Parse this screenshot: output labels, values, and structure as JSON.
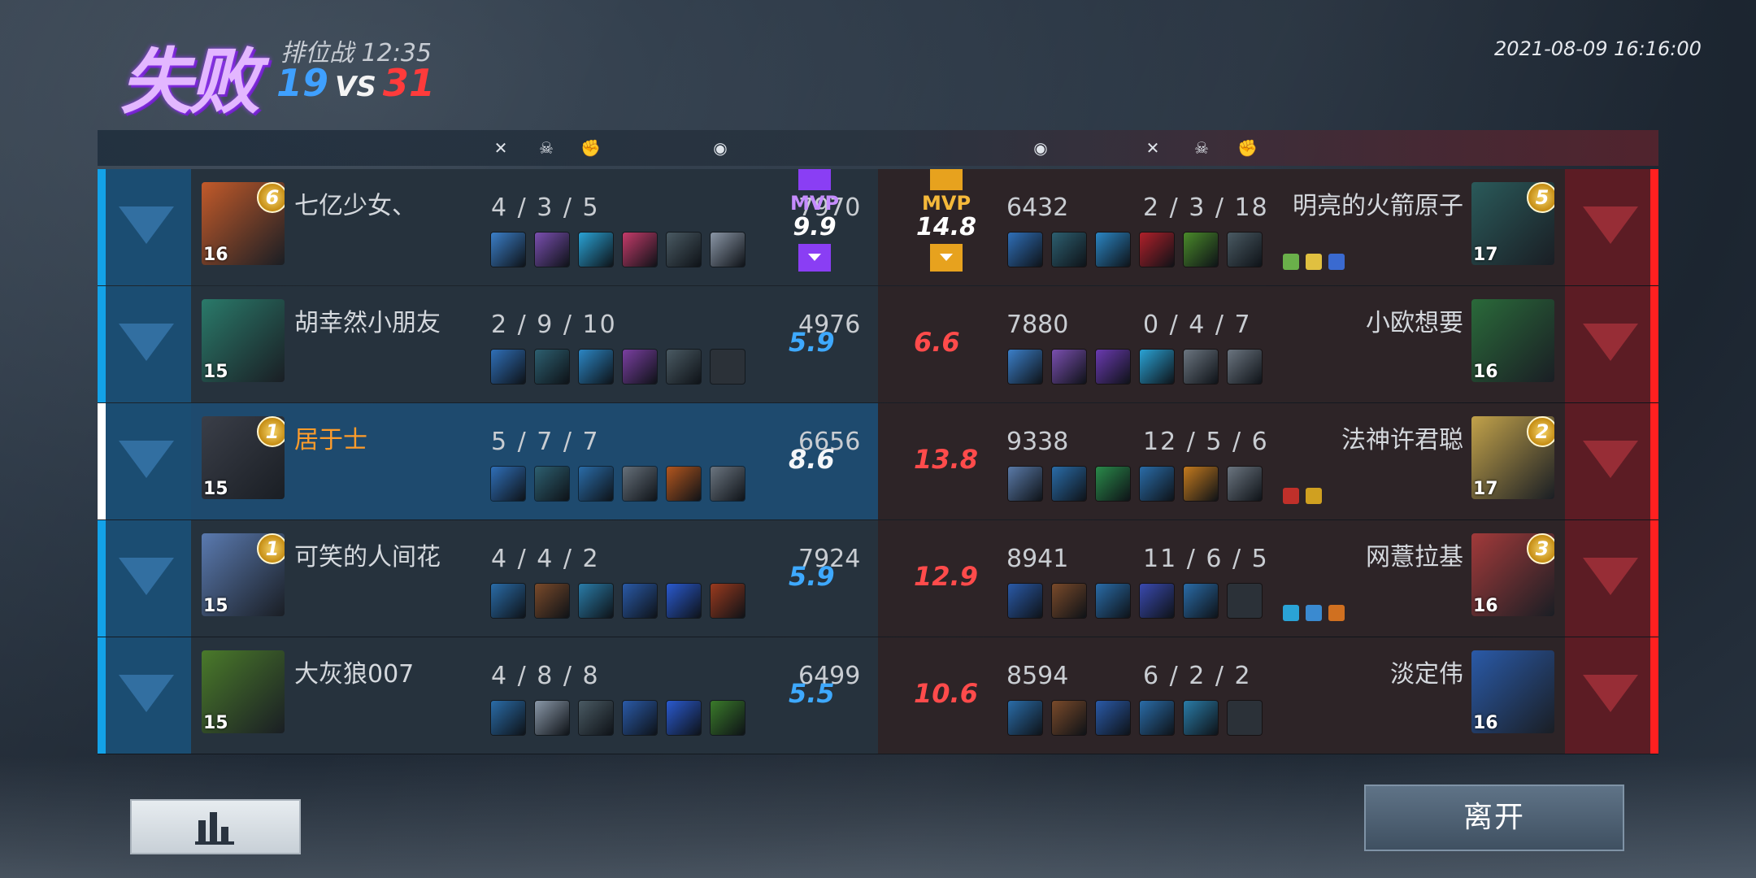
{
  "header": {
    "result": "失败",
    "mode": "排位战",
    "duration": "12:35",
    "score_blue": "19",
    "vs": "VS",
    "score_red": "31",
    "datetime": "2021-08-09 16:16:00"
  },
  "header_icons": [
    "swords-icon",
    "skull-icon",
    "fist-icon",
    "coin-icon"
  ],
  "mvp": {
    "label": "MVP"
  },
  "colors": {
    "blue_team": "#13a2e8",
    "red_team": "#ff2020",
    "self_name": "#ff9c2a",
    "mvp_purple": "#8a3ef4",
    "mvp_gold": "#e7a21e"
  },
  "blue_team": [
    {
      "name": "七亿少女、",
      "level": "16",
      "rank": "6",
      "kda": "4 / 3 / 5",
      "gold": "7970",
      "rating": "9.9",
      "mvp": true,
      "self": false,
      "items": [
        "#3b7fc9",
        "#7a4fb0",
        "#2aa3d6",
        "#c43b6a",
        "#4a5a63",
        "#8a96a6"
      ]
    },
    {
      "name": "胡幸然小朋友",
      "level": "15",
      "rank": "",
      "kda": "2 / 9 / 10",
      "gold": "4976",
      "rating": "5.9",
      "mvp": false,
      "self": false,
      "items": [
        "#2f6fb8",
        "#2d5f70",
        "#2b86c4",
        "#7a3fa1",
        "#4a5a63",
        ""
      ]
    },
    {
      "name": "居于士",
      "level": "15",
      "rank": "1",
      "kda": "5 / 7 / 7",
      "gold": "6656",
      "rating": "8.6",
      "mvp": false,
      "self": true,
      "items": [
        "#2f6fb8",
        "#2d5f70",
        "#2a6ca8",
        "#66707a",
        "#b3561e",
        "#6b7580"
      ]
    },
    {
      "name": "可笑的人间花",
      "level": "15",
      "rank": "1",
      "kda": "4 / 4 / 2",
      "gold": "7924",
      "rating": "5.9",
      "mvp": false,
      "self": false,
      "items": [
        "#2a6ca8",
        "#7a4a2a",
        "#2a7ca8",
        "#2a5aa8",
        "#2a5ad0",
        "#9a3a1e"
      ]
    },
    {
      "name": "大灰狼007",
      "level": "15",
      "rank": "",
      "kda": "4 / 8 / 8",
      "gold": "6499",
      "rating": "5.5",
      "mvp": false,
      "self": false,
      "items": [
        "#2a6ca8",
        "#8a98a8",
        "#4a5a63",
        "#2a5aa8",
        "#2a5ad0",
        "#3a7a2a"
      ]
    }
  ],
  "red_team": [
    {
      "name": "明亮的火箭原子",
      "level": "17",
      "rank": "5",
      "kda": "2 / 3 / 18",
      "gold": "6432",
      "rating": "14.8",
      "mvp": true,
      "items": [
        "#2f6fb8",
        "#2d5f70",
        "#2b86c4",
        "#b0202a",
        "#4a8a2a",
        "#4a5a63"
      ],
      "badges": [
        "#6ab04a",
        "#e0c040",
        "#3a6ad0"
      ]
    },
    {
      "name": "小欧想要",
      "level": "16",
      "rank": "",
      "kda": "0 / 4 / 7",
      "gold": "7880",
      "rating": "6.6",
      "mvp": false,
      "items": [
        "#3b7fc9",
        "#7a4fb0",
        "#6a3ab0",
        "#2aa3d6",
        "#6b7580",
        "#6b7580"
      ],
      "badges": []
    },
    {
      "name": "法神许君聪",
      "level": "17",
      "rank": "2",
      "kda": "12 / 5 / 6",
      "gold": "9338",
      "rating": "13.8",
      "mvp": false,
      "items": [
        "#5a7aa8",
        "#2a6ca8",
        "#2a8a4a",
        "#2a6ca8",
        "#c47a1e",
        "#6b7580"
      ],
      "badges": [
        "#c0302a",
        "#d0a020"
      ]
    },
    {
      "name": "网薏拉基",
      "level": "16",
      "rank": "3",
      "kda": "11 / 6 / 5",
      "gold": "8941",
      "rating": "12.9",
      "mvp": false,
      "items": [
        "#2a5aa8",
        "#7a4a2a",
        "#2a6ca8",
        "#3a4ab0",
        "#2a6ca8",
        ""
      ],
      "badges": [
        "#2aa3d6",
        "#3a8ad0",
        "#d07020"
      ]
    },
    {
      "name": "淡定伟",
      "level": "16",
      "rank": "",
      "kda": "6 / 2 / 2",
      "gold": "8594",
      "rating": "10.6",
      "mvp": false,
      "items": [
        "#2a6ca8",
        "#7a4a2a",
        "#2a5aa8",
        "#2a6ca8",
        "#2a7ca8",
        ""
      ],
      "badges": []
    }
  ],
  "buttons": {
    "leave": "离开"
  }
}
